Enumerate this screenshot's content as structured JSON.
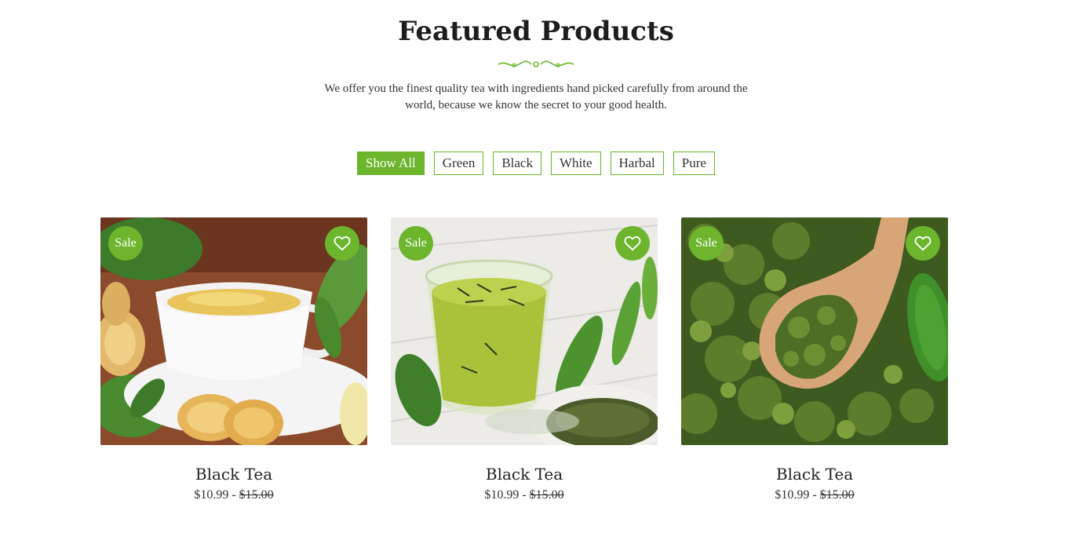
{
  "section": {
    "title": "Featured Products",
    "subtitle": "We offer you the finest quality tea with ingredients hand picked carefully from around the world, because we know the secret to your good health."
  },
  "filters": [
    {
      "label": "Show All",
      "active": true
    },
    {
      "label": "Green",
      "active": false
    },
    {
      "label": "Black",
      "active": false
    },
    {
      "label": "White",
      "active": false
    },
    {
      "label": "Harbal",
      "active": false
    },
    {
      "label": "Pure",
      "active": false
    }
  ],
  "products": [
    {
      "badge": "Sale",
      "name": "Black Tea",
      "price": "$10.99",
      "separator": " - ",
      "old_price": "$15.00",
      "image": "ginger-tea-cup"
    },
    {
      "badge": "Sale",
      "name": "Black Tea",
      "price": "$10.99",
      "separator": " - ",
      "old_price": "$15.00",
      "image": "green-tea-glass"
    },
    {
      "badge": "Sale",
      "name": "Black Tea",
      "price": "$10.99",
      "separator": " - ",
      "old_price": "$15.00",
      "image": "loose-leaf-scoop"
    }
  ],
  "colors": {
    "accent": "#6cb52d",
    "text": "#222222"
  },
  "icons": {
    "wishlist": "heart-icon",
    "divider": "flourish-divider-icon"
  }
}
